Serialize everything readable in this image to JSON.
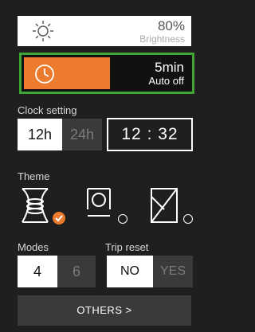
{
  "brightness": {
    "percent": "80%",
    "label": "Brightness",
    "level": 0.8,
    "icon": "sun-icon"
  },
  "auto_off": {
    "value": "5min",
    "label": "Auto off",
    "icon": "clock-icon",
    "accent": "#ec7a2f",
    "highlight": "#3fa535"
  },
  "clock_setting": {
    "label": "Clock setting",
    "formats": [
      "12h",
      "24h"
    ],
    "selected": "12h",
    "time": "12 : 32"
  },
  "theme": {
    "label": "Theme",
    "options": [
      "theme-rolls-icon",
      "theme-round-icon",
      "theme-diagonal-icon"
    ],
    "selected": 0
  },
  "modes": {
    "label": "Modes",
    "options": [
      "4",
      "6"
    ],
    "selected": "4"
  },
  "trip_reset": {
    "label": "Trip reset",
    "options": [
      "NO",
      "YES"
    ],
    "selected": "NO"
  },
  "others": {
    "label": "OTHERS >"
  }
}
